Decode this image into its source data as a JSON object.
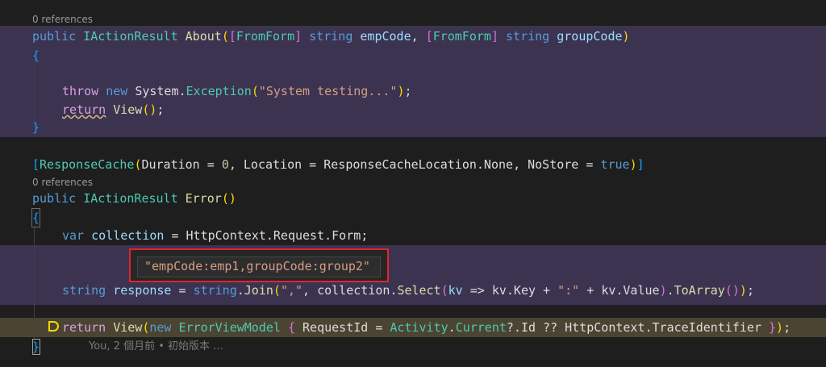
{
  "editor": {
    "codelens_1": "0 references",
    "codelens_2": "0 references",
    "about": {
      "kw_public": "public",
      "ret_type": "IActionResult",
      "name": "About",
      "attr1": "FromForm",
      "kw_string1": "string",
      "p1": "empCode",
      "attr2": "FromForm",
      "kw_string2": "string",
      "p2": "groupCode"
    },
    "throw_line": {
      "kw_throw": "throw",
      "kw_new": "new",
      "ns": "System.",
      "type": "Exception",
      "arg": "\"System testing...\""
    },
    "return_view": {
      "kw_return": "return",
      "call": "View"
    },
    "response_cache": {
      "attr": "ResponseCache",
      "duration_label": "Duration",
      "duration_value": "0",
      "location_label": "Location",
      "location_value": "ResponseCacheLocation.None",
      "nostore_label": "NoStore",
      "nostore_value": "true"
    },
    "error_sig": {
      "kw_public": "public",
      "ret_type": "IActionResult",
      "name": "Error"
    },
    "var_line": {
      "kw_var": "var",
      "name": "collection",
      "rhs": "HttpContext.Request.Form;"
    },
    "tooltip_value": "\"empCode:emp1,groupCode:group2\"",
    "join_line": {
      "kw_string": "string",
      "name": "response",
      "kw_string2": "string",
      "join": "Join",
      "sep": "\",\"",
      "coll": "collection.",
      "select": "Select",
      "lambda_param": "kv",
      "key": "kv.Key",
      "colon": "\":\"",
      "value": "kv.Value",
      "toarray": "ToArray"
    },
    "return_line": {
      "kw_return": "return",
      "call": "View",
      "kw_new": "new",
      "type": "ErrorViewModel",
      "prop": "RequestId",
      "activity": "Activity",
      "current": "Current",
      "id": "?.Id ?? HttpContext.TraceIdentifier"
    },
    "blame": "You, 2 個月前 • 初始版本 …"
  }
}
